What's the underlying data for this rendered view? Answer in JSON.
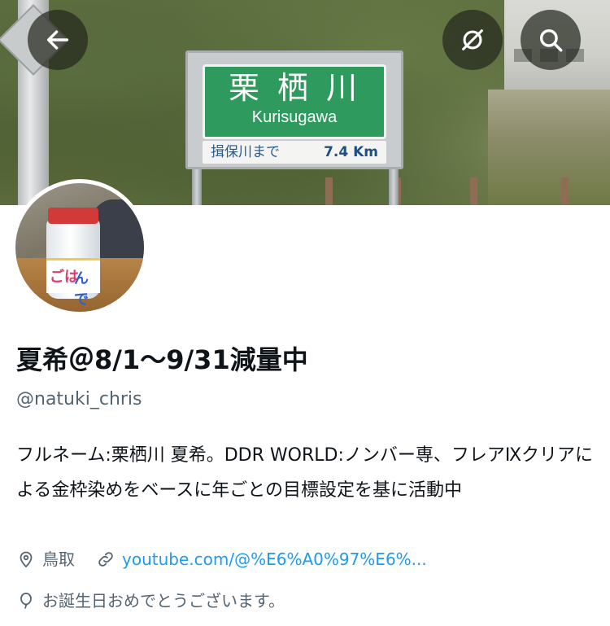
{
  "header": {
    "sign": {
      "kanji": "栗栖川",
      "romaji": "Kurisugawa",
      "route": "揖保川まで",
      "distance": "7.4 Km"
    },
    "buttons": [
      "back-arrow-icon",
      "unmute-icon",
      "search-icon"
    ]
  },
  "avatar": {
    "label_text_1": "ごは",
    "label_text_2": "んで"
  },
  "profile": {
    "display_name": "夏希＠8/1〜9/31減量中",
    "handle": "@natuki_chris",
    "bio": "フルネーム:栗栖川 夏希。DDR WORLD:ノンバー専、フレアⅨクリアによる金枠染めをベースに年ごとの目標設定を基に活動中",
    "location": "鳥取",
    "website": "youtube.com/@%E6%A0%97%E6%...",
    "birthday_message": "お誕生日おめでとうございます。"
  },
  "colors": {
    "link": "#1d9bf0",
    "secondary_text": "#536471",
    "primary_text": "#0f1419"
  }
}
